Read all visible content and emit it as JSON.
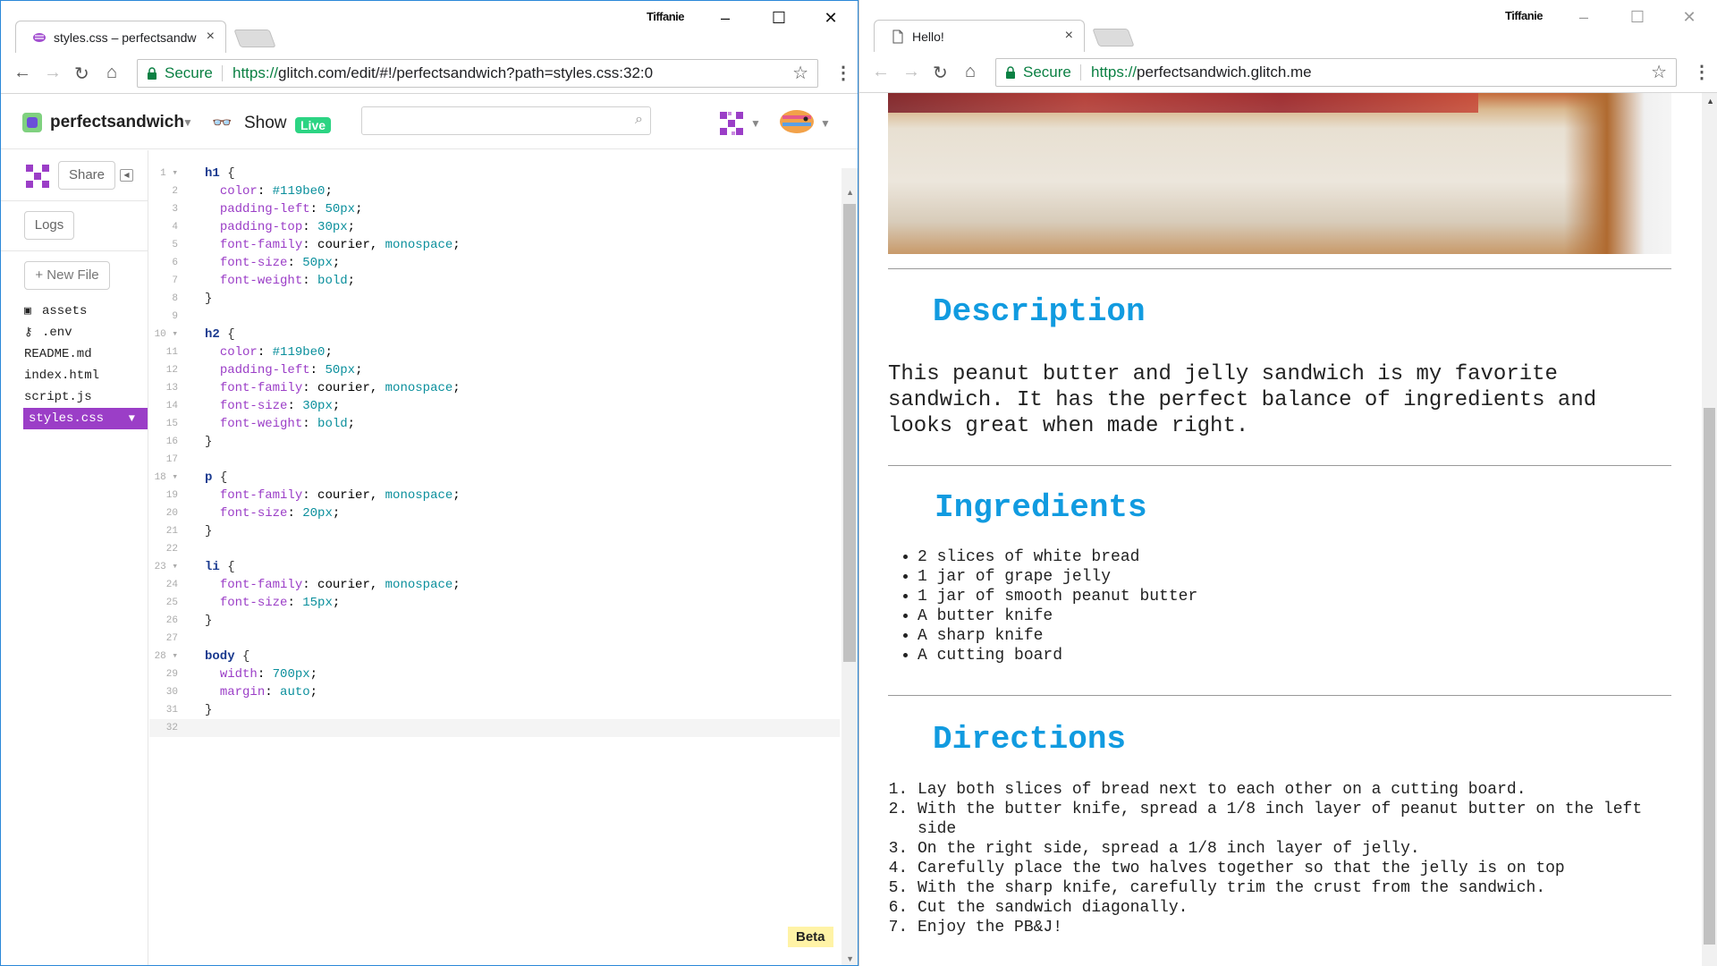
{
  "left_window": {
    "tab_title": "styles.css – perfectsandwich",
    "username": "Tiffanie",
    "url_secure": "Secure",
    "url_scheme": "https://",
    "url_rest": "glitch.com/edit/#!/perfectsandwich?path=styles.css:32:0",
    "project_name": "perfectsandwich",
    "show_label": "Show",
    "live_label": "Live",
    "share_label": "Share",
    "logs_label": "Logs",
    "new_file_label": "+ New File",
    "files": [
      {
        "name": "assets",
        "icon": "box-icon"
      },
      {
        "name": ".env",
        "icon": "key-icon"
      },
      {
        "name": "README.md",
        "icon": ""
      },
      {
        "name": "index.html",
        "icon": ""
      },
      {
        "name": "script.js",
        "icon": ""
      },
      {
        "name": "styles.css",
        "icon": "",
        "active": true
      }
    ],
    "beta_label": "Beta",
    "code_lines": [
      {
        "n": "1",
        "html": "<span class='sel'>h1</span> <span class='brace'>{</span>"
      },
      {
        "n": "2",
        "html": "  <span class='prop'>color</span>: <span class='val'>#119be0</span>;"
      },
      {
        "n": "3",
        "html": "  <span class='prop'>padding-left</span>: <span class='val'>50px</span>;"
      },
      {
        "n": "4",
        "html": "  <span class='prop'>padding-top</span>: <span class='val'>30px</span>;"
      },
      {
        "n": "5",
        "html": "  <span class='prop'>font-family</span>: courier, <span class='val'>monospace</span>;"
      },
      {
        "n": "6",
        "html": "  <span class='prop'>font-size</span>: <span class='val'>50px</span>;"
      },
      {
        "n": "7",
        "html": "  <span class='prop'>font-weight</span>: <span class='val'>bold</span>;"
      },
      {
        "n": "8",
        "html": "<span class='brace'>}</span>"
      },
      {
        "n": "9",
        "html": ""
      },
      {
        "n": "10",
        "html": "<span class='sel'>h2</span> <span class='brace'>{</span>"
      },
      {
        "n": "11",
        "html": "  <span class='prop'>color</span>: <span class='val'>#119be0</span>;"
      },
      {
        "n": "12",
        "html": "  <span class='prop'>padding-left</span>: <span class='val'>50px</span>;"
      },
      {
        "n": "13",
        "html": "  <span class='prop'>font-family</span>: courier, <span class='val'>monospace</span>;"
      },
      {
        "n": "14",
        "html": "  <span class='prop'>font-size</span>: <span class='val'>30px</span>;"
      },
      {
        "n": "15",
        "html": "  <span class='prop'>font-weight</span>: <span class='val'>bold</span>;"
      },
      {
        "n": "16",
        "html": "<span class='brace'>}</span>"
      },
      {
        "n": "17",
        "html": ""
      },
      {
        "n": "18",
        "html": "<span class='sel'>p</span> <span class='brace'>{</span>"
      },
      {
        "n": "19",
        "html": "  <span class='prop'>font-family</span>: courier, <span class='val'>monospace</span>;"
      },
      {
        "n": "20",
        "html": "  <span class='prop'>font-size</span>: <span class='val'>20px</span>;"
      },
      {
        "n": "21",
        "html": "<span class='brace'>}</span>"
      },
      {
        "n": "22",
        "html": ""
      },
      {
        "n": "23",
        "html": "<span class='sel'>li</span> <span class='brace'>{</span>"
      },
      {
        "n": "24",
        "html": "  <span class='prop'>font-family</span>: courier, <span class='val'>monospace</span>;"
      },
      {
        "n": "25",
        "html": "  <span class='prop'>font-size</span>: <span class='val'>15px</span>;"
      },
      {
        "n": "26",
        "html": "<span class='brace'>}</span>"
      },
      {
        "n": "27",
        "html": ""
      },
      {
        "n": "28",
        "html": "<span class='sel'>body</span> <span class='brace'>{</span>"
      },
      {
        "n": "29",
        "html": "  <span class='prop'>width</span>: <span class='val'>700px</span>;"
      },
      {
        "n": "30",
        "html": "  <span class='prop'>margin</span>: <span class='val'>auto</span>;"
      },
      {
        "n": "31",
        "html": "<span class='brace'>}</span>"
      },
      {
        "n": "32",
        "html": ""
      }
    ]
  },
  "right_window": {
    "tab_title": "Hello!",
    "username": "Tiffanie",
    "url_secure": "Secure",
    "url_scheme": "https://",
    "url_rest": "perfectsandwich.glitch.me",
    "description_heading": "Description",
    "description_text": "This peanut butter and jelly sandwich is my favorite sandwich. It has the perfect balance of ingredients and looks great when made right.",
    "ingredients_heading": "Ingredients",
    "ingredients": [
      "2 slices of white bread",
      "1 jar of grape jelly",
      "1 jar of smooth peanut butter",
      "A butter knife",
      "A sharp knife",
      "A cutting board"
    ],
    "directions_heading": "Directions",
    "directions": [
      "Lay both slices of bread next to each other on a cutting board.",
      "With the butter knife, spread a 1/8 inch layer of peanut butter on the left side",
      "On the right side, spread a 1/8 inch layer of jelly.",
      "Carefully place the two halves together so that the jelly is on top",
      "With the sharp knife, carefully trim the crust from the sandwich.",
      "Cut the sandwich diagonally.",
      "Enjoy the PB&J!"
    ]
  },
  "colors": {
    "heading_blue": "#119be0",
    "glitch_purple": "#9b3ec7",
    "live_green": "#2cd483",
    "secure_green": "#0b8043"
  }
}
